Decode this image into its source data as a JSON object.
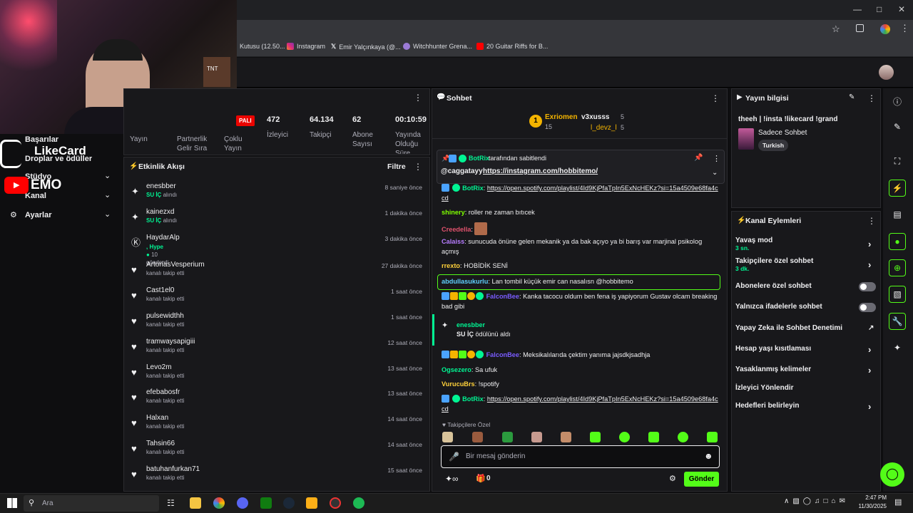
{
  "browser": {
    "bookmarks": [
      {
        "label": "Kutusu (12.50...",
        "color": "#8ab4f8"
      },
      {
        "label": "Instagram",
        "color": "#e1306c"
      },
      {
        "label": "Emir Yalçınkaya (@...",
        "color": "#ffffff"
      },
      {
        "label": "Witchhunter Grena...",
        "color": "#9b7bd6"
      },
      {
        "label": "20 Guitar Riffs for B...",
        "color": "#ff0000"
      }
    ]
  },
  "overlay": {
    "brand": "LikeCard",
    "yt_text": "EMO"
  },
  "sidebar": {
    "items": [
      {
        "label": "Başarılar"
      },
      {
        "label": "Droplar ve ödüller"
      },
      {
        "label": "Stüdyo"
      },
      {
        "label": "Kanal"
      },
      {
        "label": "Ayarlar"
      }
    ]
  },
  "stats": {
    "live_badge": "PALI",
    "items": [
      {
        "value": "",
        "label": "Yayın"
      },
      {
        "value": "",
        "label": "Partnerlik Gelir Sıra"
      },
      {
        "value": "",
        "label": "Çoklu Yayın"
      },
      {
        "value": "472",
        "label": "İzleyici"
      },
      {
        "value": "64.134",
        "label": "Takipçi"
      },
      {
        "value": "62",
        "label": "Abone Sayısı"
      },
      {
        "value": "00:10:59",
        "label": "Yayında Olduğu Süre"
      }
    ]
  },
  "activity": {
    "title": "Etkinlik Akışı",
    "filter": "Filtre",
    "items": [
      {
        "name": "enesbber",
        "sub": "SU İÇ",
        "sub2": "alındı",
        "time": "8 saniye önce",
        "icon": "reward"
      },
      {
        "name": "kainezxd",
        "sub": "SU İÇ",
        "sub2": "alındı",
        "time": "1 dakika önce",
        "icon": "reward"
      },
      {
        "name": "HaydarAlp",
        "sub": ", Hype",
        "sub2": "10",
        "sub3": "gönderdi",
        "time": "3 dakika önce",
        "icon": "kick"
      },
      {
        "name": "ArtoriasVesperium",
        "sub2": "kanalı takip etti",
        "time": "27 dakika önce",
        "icon": "heart"
      },
      {
        "name": "Cast1el0",
        "sub2": "kanalı takip etti",
        "time": "1 saat önce",
        "icon": "heart"
      },
      {
        "name": "pulsewidthh",
        "sub2": "kanalı takip etti",
        "time": "1 saat önce",
        "icon": "heart"
      },
      {
        "name": "tramwaysapigiii",
        "sub2": "kanalı takip etti",
        "time": "12 saat önce",
        "icon": "heart"
      },
      {
        "name": "Levo2m",
        "sub2": "kanalı takip etti",
        "time": "13 saat önce",
        "icon": "heart"
      },
      {
        "name": "efebabosfr",
        "sub2": "kanalı takip etti",
        "time": "13 saat önce",
        "icon": "heart"
      },
      {
        "name": "Halxan",
        "sub2": "kanalı takip etti",
        "time": "14 saat önce",
        "icon": "heart"
      },
      {
        "name": "Tahsin66",
        "sub2": "kanalı takip etti",
        "time": "14 saat önce",
        "icon": "heart"
      },
      {
        "name": "batuhanfurkan71",
        "sub2": "kanalı takip etti",
        "time": "15 saat önce",
        "icon": "heart"
      }
    ]
  },
  "chat": {
    "title": "Sohbet",
    "leaderboard": {
      "rank": "1",
      "first_name": "Exriomen",
      "first_count": "15",
      "second_name": "v3xusss",
      "second_count": "5",
      "third_name": "l_devz_l",
      "third_count": "5"
    },
    "pinned": {
      "by": "BotRix",
      "by_suffix": "tarafından sabitlendi",
      "mention": "@caggatayy",
      "link": "https://instagram.com/hobbitemo/"
    },
    "messages": [
      {
        "user": "BotRix",
        "color": "#00f593",
        "text": "",
        "link": "https://open.spotify.com/playlist/4Id9KjPfaTpIn5ExNcHEKz?si=15a4509e68fa4ccd",
        "badges": true
      },
      {
        "user": "shinery",
        "color": "#7fff00",
        "text": "roller ne zaman bıtıcek"
      },
      {
        "user": "Creedella",
        "color": "#e0526d",
        "text": ""
      },
      {
        "user": "Calaiss",
        "color": "#b67cff",
        "text": "sunucuda önüne gelen mekanik ya da bak açıyo ya bi barış var marjinal psikolog açmış"
      },
      {
        "user": "rrexto",
        "color": "#ffd13a",
        "text": "HOBİDİK SENİ"
      },
      {
        "user": "abdullasukurlu",
        "color": "#5fd0ff",
        "text": "Lan tombil küçük emir can nasalısn @hobbitemo"
      },
      {
        "user": "FalconBee",
        "color": "#7a5cff",
        "text": "Kanka tacocu oldum ben fena iş yapiyorum Gustav olcam breaking bad gibi"
      },
      {
        "user": "FalconBee",
        "color": "#7a5cff",
        "text": "Meksikalılarıda çektim yanıma jajsdkjsadhja"
      },
      {
        "user": "Ogsezero",
        "color": "#00f593",
        "text": "Sa ufuk"
      },
      {
        "user": "VurucuBrs",
        "color": "#ffd13a",
        "text": "!spotify"
      },
      {
        "user": "BotRix",
        "color": "#00f593",
        "text": "",
        "link": "https://open.spotify.com/playlist/4Id9KjPfaTpIn5ExNcHEKz?si=15a4509e68fa4ccd"
      }
    ],
    "redeem": {
      "user": "enesbber",
      "reward": "SU İÇ",
      "suffix": "ödülünü aldı"
    },
    "followers_only": "Takipçilere Özel",
    "input_placeholder": "Bir mesaj gönderin",
    "points": "0",
    "send": "Gönder"
  },
  "stream_info": {
    "title": "Yayın bilgisi",
    "stream_title": "theeh | !insta !likecard !grand",
    "category": "Sadece Sohbet",
    "tag": "Turkish"
  },
  "channel_actions": {
    "title": "Kanal Eylemleri",
    "items": [
      {
        "label": "Yavaş mod",
        "sub": "3 sn.",
        "control": "chevron"
      },
      {
        "label": "Takipçilere özel sohbet",
        "sub": "3 dk.",
        "control": "chevron"
      },
      {
        "label": "Abonelere özel sohbet",
        "control": "toggle"
      },
      {
        "label": "Yalnızca ifadelerle sohbet",
        "control": "toggle"
      },
      {
        "label": "Yapay Zeka ile Sohbet Denetimi",
        "control": "external"
      },
      {
        "label": "Hesap yaşı kısıtlaması",
        "control": "chevron"
      },
      {
        "label": "Yasaklanmış kelimeler",
        "control": "chevron"
      },
      {
        "label": "İzleyici Yönlendir",
        "control": "none"
      },
      {
        "label": "Hedefleri belirleyin",
        "control": "chevron"
      }
    ]
  },
  "taskbar": {
    "search": "Ara",
    "time": "2:47 PM",
    "date": "11/30/2025"
  },
  "colors": {
    "accent": "#53fc18",
    "bg": "#0e0e10",
    "panel": "#18181b"
  }
}
